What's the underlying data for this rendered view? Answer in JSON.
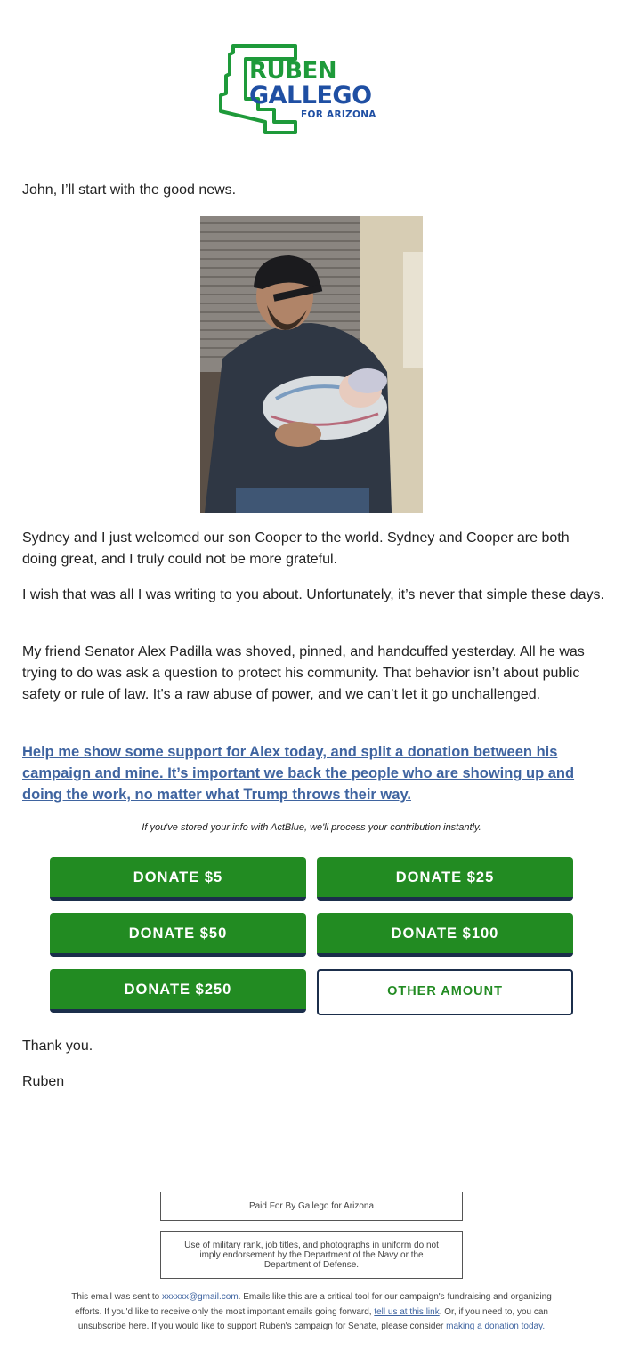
{
  "logo": {
    "line1": "RUBEN",
    "line2": "GALLEGO",
    "line3": "FOR ARIZONA",
    "colors": {
      "green": "#1e9a3a",
      "blue": "#1f4fa3"
    }
  },
  "email": {
    "greeting": "John, I’ll start with the good news.",
    "photo_icon": "father-holding-newborn-photo",
    "paragraph1": "Sydney and I just welcomed our son Cooper to the world. Sydney and Cooper are both doing great, and I truly could not be more grateful.",
    "paragraph2": "I wish that was all I was writing to you about. Unfortunately, it’s never that simple these days.",
    "paragraph3": "My friend Senator Alex Padilla was shoved, pinned, and handcuffed yesterday. All he was trying to do was ask a question to protect his community. That behavior isn’t about public safety or rule of law. It's a raw abuse of power, and we can’t let it go unchallenged.",
    "cta_link": "Help me show some support for Alex today, and split a donation between his campaign and mine. It’s important we back the people who are showing up and doing the work, no matter what Trump throws their way.",
    "actblue_note": "If you've stored your info with ActBlue, we'll process your contribution instantly.",
    "buttons": {
      "donate5": "DONATE $5",
      "donate25": "DONATE $25",
      "donate50": "DONATE $50",
      "donate100": "DONATE $100",
      "donate250": "DONATE $250",
      "other": "OTHER AMOUNT"
    },
    "thanks": "Thank you.",
    "signature": "Ruben"
  },
  "footer": {
    "paid_for": "Paid For By Gallego for Arizona",
    "disclaimer": "Use of military rank, job titles, and photographs in uniform do not imply endorsement by the Department of the Navy or the Department of Defense.",
    "sent_to_prefix": "This email was sent to ",
    "email_address": "xxxxxx@gmail.com",
    "sent_to_suffix": ". Emails like this are a critical tool for our campaign's fundraising and organizing efforts. If you'd like to receive only the most important emails going forward, ",
    "tell_us_link": "tell us at this link",
    "mid_text": ". Or, if you need to, you can unsubscribe here. If you would like to support Ruben's campaign for Senate, please consider ",
    "donation_link": "making a donation today."
  },
  "colors": {
    "button_green": "#228b22",
    "button_border": "#1b2e4b",
    "link_blue": "#3f64a0"
  }
}
